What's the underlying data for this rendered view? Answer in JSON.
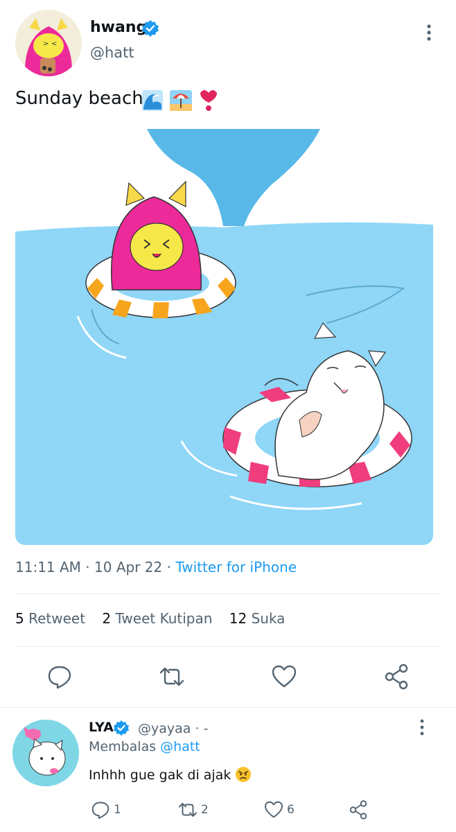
{
  "tweet": {
    "author_name": "hwang",
    "author_handle": "@hatt",
    "text": "Sunday beach",
    "emojis": [
      "wave-emoji",
      "beach-umbrella-emoji",
      "heart-exclamation-emoji"
    ],
    "time": "11:11 AM",
    "date": "10 Apr 22",
    "source": "Twitter for iPhone",
    "separator": "·",
    "stats": {
      "retweets": "5",
      "retweets_label": "Retweet",
      "quotes": "2",
      "quotes_label": "Tweet Kutipan",
      "likes": "12",
      "likes_label": "Suka"
    },
    "actions": [
      "reply-icon",
      "retweet-icon",
      "like-icon",
      "share-icon"
    ]
  },
  "reply": {
    "author_name": "LYA",
    "author_handle": "@yayaa",
    "dot": "·",
    "dash": "-",
    "replying_prefix": "Membalas",
    "replying_to": "@hatt",
    "text": "Inhhh gue gak di ajak",
    "emoji": "angry-face-emoji",
    "counts": {
      "replies": "1",
      "retweets": "2",
      "likes": "6"
    }
  },
  "colors": {
    "accent": "#1d9bf0",
    "secondary_text": "#536471",
    "divider": "#e6ecf0",
    "sea": "#8fd6f7",
    "sky_water": "#58b8e8"
  }
}
